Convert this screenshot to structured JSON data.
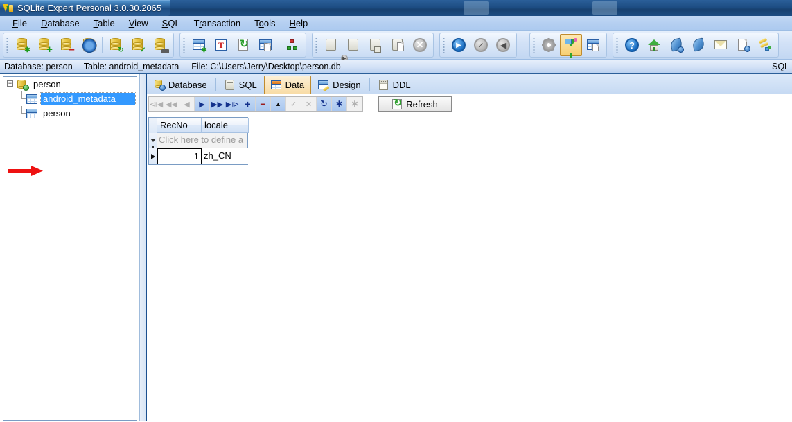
{
  "window": {
    "title": "SQLite Expert Personal 3.0.30.2065",
    "app_icon": "sqlite-expert-logo-icon"
  },
  "menubar": {
    "items": [
      {
        "label": "File",
        "accel": "F"
      },
      {
        "label": "Database",
        "accel": "D"
      },
      {
        "label": "Table",
        "accel": "T"
      },
      {
        "label": "View",
        "accel": "V"
      },
      {
        "label": "SQL",
        "accel": "S"
      },
      {
        "label": "Transaction",
        "accel": "r"
      },
      {
        "label": "Tools",
        "accel": "o"
      },
      {
        "label": "Help",
        "accel": "H"
      }
    ]
  },
  "toolbar": {
    "groups": [
      {
        "name": "database-group",
        "buttons": [
          {
            "icon": "new-database-icon",
            "active": false
          },
          {
            "icon": "add-database-icon",
            "active": false
          },
          {
            "icon": "remove-database-icon",
            "active": false
          },
          {
            "icon": "database-properties-icon",
            "active": false
          },
          {
            "separator": true
          },
          {
            "icon": "refresh-database-icon",
            "active": false
          },
          {
            "icon": "verify-database-icon",
            "active": false
          },
          {
            "icon": "compact-database-icon",
            "active": false
          }
        ]
      },
      {
        "name": "table-group",
        "buttons": [
          {
            "icon": "new-table-icon",
            "active": false
          },
          {
            "icon": "rename-table-icon",
            "active": false
          },
          {
            "icon": "refresh-table-icon",
            "active": false
          },
          {
            "icon": "duplicate-table-icon",
            "active": false
          },
          {
            "separator": true
          },
          {
            "icon": "relations-icon",
            "active": false
          }
        ]
      },
      {
        "name": "sql-group",
        "buttons": [
          {
            "icon": "execute-sql-icon",
            "active": false
          },
          {
            "icon": "execute-sql-step-icon",
            "active": false
          },
          {
            "icon": "save-sql-icon",
            "active": false
          },
          {
            "icon": "new-sql-tab-icon",
            "active": false
          },
          {
            "icon": "stop-sql-icon",
            "active": false
          }
        ]
      },
      {
        "name": "transaction-group",
        "buttons": [
          {
            "icon": "begin-transaction-icon",
            "active": false
          },
          {
            "icon": "commit-transaction-icon",
            "active": false
          },
          {
            "icon": "rollback-transaction-icon",
            "active": false
          }
        ]
      },
      {
        "name": "view-group",
        "buttons": [
          {
            "icon": "options-gear-icon",
            "active": false
          },
          {
            "icon": "filter-funnel-icon",
            "active": true
          },
          {
            "icon": "grid-layout-icon",
            "active": false
          }
        ]
      },
      {
        "name": "help-group",
        "buttons": [
          {
            "icon": "help-question-icon",
            "active": false
          },
          {
            "icon": "home-page-icon",
            "active": false
          },
          {
            "icon": "feather-help-icon",
            "active": false
          },
          {
            "icon": "feather-icon",
            "active": false
          },
          {
            "icon": "email-icon",
            "active": false
          },
          {
            "icon": "about-document-icon",
            "active": false
          },
          {
            "icon": "register-keys-icon",
            "active": false
          }
        ]
      }
    ]
  },
  "infobar": {
    "database_label": "Database: person",
    "table_label": "Table: android_metadata",
    "file_label": "File: C:\\Users\\Jerry\\Desktop\\person.db",
    "right_label": "SQL"
  },
  "tree": {
    "root": {
      "label": "person",
      "icon": "database-node-icon",
      "expanded": true,
      "expander": "−"
    },
    "children": [
      {
        "label": "android_metadata",
        "icon": "table-node-icon",
        "selected": true
      },
      {
        "label": "person",
        "icon": "table-node-icon",
        "selected": false
      }
    ],
    "annotation": {
      "type": "red-arrow",
      "target": "android_metadata",
      "color": "#ee1111"
    }
  },
  "tabs": {
    "items": [
      {
        "label": "Database",
        "icon": "database-tab-icon",
        "active": false
      },
      {
        "label": "SQL",
        "icon": "sql-tab-icon",
        "active": false
      },
      {
        "label": "Data",
        "icon": "data-tab-icon",
        "active": true
      },
      {
        "label": "Design",
        "icon": "design-tab-icon",
        "active": false
      },
      {
        "label": "DDL",
        "icon": "ddl-tab-icon",
        "active": false
      }
    ]
  },
  "navigator": {
    "buttons": [
      {
        "name": "first-record-button",
        "glyph": "⧏◀",
        "state": "off"
      },
      {
        "name": "prior-page-button",
        "glyph": "◀◀",
        "state": "off"
      },
      {
        "name": "prior-record-button",
        "glyph": "◀",
        "state": "off"
      },
      {
        "name": "next-record-button",
        "glyph": "▶",
        "state": "on"
      },
      {
        "name": "next-page-button",
        "glyph": "▶▶",
        "state": "on"
      },
      {
        "name": "last-record-button",
        "glyph": "▶⧐",
        "state": "on"
      },
      {
        "name": "insert-record-button",
        "glyph": "+",
        "state": "on"
      },
      {
        "name": "delete-record-button",
        "glyph": "−",
        "state": "on"
      },
      {
        "name": "edit-record-button",
        "glyph": "▲",
        "state": "on"
      },
      {
        "name": "post-edit-button",
        "glyph": "✓",
        "state": "off"
      },
      {
        "name": "cancel-edit-button",
        "glyph": "✕",
        "state": "off"
      },
      {
        "name": "refresh-record-button",
        "glyph": "↻",
        "state": "on"
      },
      {
        "name": "clear-filter-button",
        "glyph": "✱",
        "state": "on"
      },
      {
        "name": "apply-filter-button",
        "glyph": "✱",
        "state": "off"
      }
    ],
    "refresh_button": {
      "label": "Refresh",
      "icon": "refresh-icon"
    }
  },
  "grid": {
    "columns": [
      "RecNo",
      "locale"
    ],
    "filter_row_text": "Click here to define a",
    "filter_icon": "filter-funnel-icon",
    "row_indicator": "current-row-arrow-icon",
    "rows": [
      {
        "RecNo": "1",
        "locale": "zh_CN"
      }
    ]
  },
  "colors": {
    "title_bar": "#1d4d83",
    "menu_bar": "#b5cff1",
    "toolbar": "#d3e2f7",
    "selection": "#3399ff",
    "active_tab": "#f8dca6",
    "active_tab_border": "#c08b2e",
    "annotation_red": "#ee1111",
    "panel_border": "#1a4f8f"
  }
}
